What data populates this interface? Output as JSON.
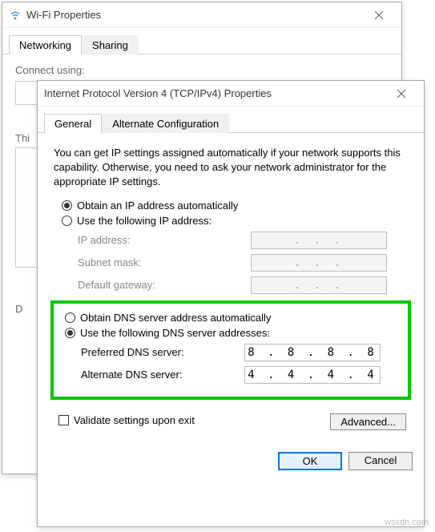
{
  "wifi": {
    "title": "Wi-Fi Properties",
    "tabs": {
      "networking": "Networking",
      "sharing": "Sharing"
    },
    "connect_label": "Connect using:",
    "this_label": "Thi",
    "description_prefix": "D"
  },
  "ipv4": {
    "title": "Internet Protocol Version 4 (TCP/IPv4) Properties",
    "tabs": {
      "general": "General",
      "alternate": "Alternate Configuration"
    },
    "description": "You can get IP settings assigned automatically if your network supports this capability. Otherwise, you need to ask your network administrator for the appropriate IP settings.",
    "ip_section": {
      "auto": "Obtain an IP address automatically",
      "manual": "Use the following IP address:",
      "ip_label": "IP address:",
      "subnet_label": "Subnet mask:",
      "gateway_label": "Default gateway:",
      "ip_value": ".     .     .",
      "subnet_value": ".     .     .",
      "gateway_value": ".     .     .",
      "selected": "auto"
    },
    "dns_section": {
      "auto": "Obtain DNS server address automatically",
      "manual": "Use the following DNS server addresses:",
      "preferred_label": "Preferred DNS server:",
      "alternate_label": "Alternate DNS server:",
      "preferred_value": "8 . 8 . 8 . 8",
      "alternate_value": "4 . 4 . 4 . 4",
      "selected": "manual"
    },
    "validate": "Validate settings upon exit",
    "advanced": "Advanced...",
    "ok": "OK",
    "cancel": "Cancel"
  },
  "watermark": "wsxdn.com"
}
